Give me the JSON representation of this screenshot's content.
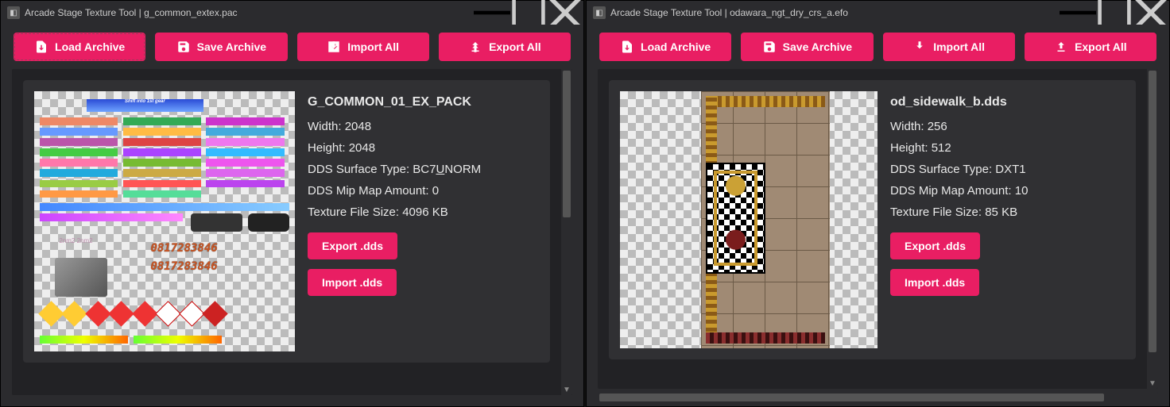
{
  "app_name": "Arcade Stage Texture Tool",
  "toolbar": {
    "load": "Load Archive",
    "save": "Save Archive",
    "import_all": "Import All",
    "export_all": "Export All"
  },
  "meta_labels": {
    "width": "Width: ",
    "height": "Height: ",
    "surface": "DDS Surface Type: ",
    "mip": "DDS Mip Map Amount: ",
    "filesize": "Texture File Size: "
  },
  "actions": {
    "export_dds": "Export .dds",
    "import_dds": "Import .dds"
  },
  "windows": [
    {
      "file": "g_common_extex.pac",
      "texture": {
        "name": "G_COMMON_01_EX_PACK",
        "width": "2048",
        "height": "2048",
        "surface_pre": "BC7",
        "surface_u": "U",
        "surface_post": "NORM",
        "mip": "0",
        "filesize": "4096 KB"
      }
    },
    {
      "file": "odawara_ngt_dry_crs_a.efo",
      "texture": {
        "name": "od_sidewalk_b.dds",
        "width": "256",
        "height": "512",
        "surface": "DXT1",
        "mip": "10",
        "filesize": "85 KB"
      }
    }
  ]
}
